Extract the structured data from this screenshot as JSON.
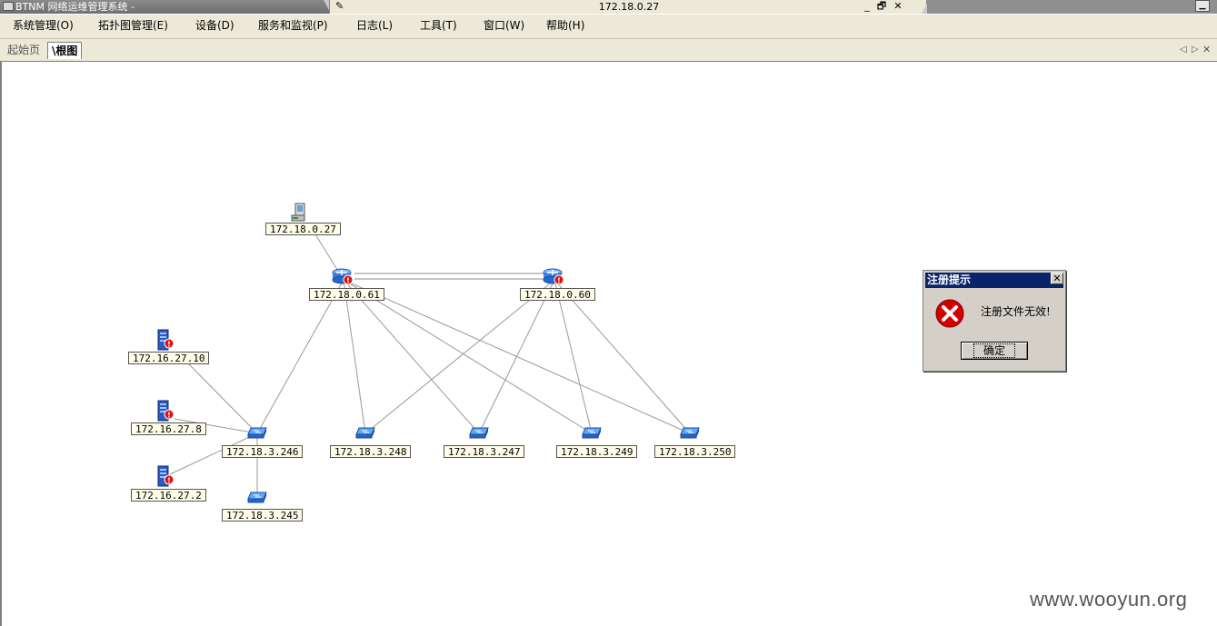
{
  "window": {
    "app_title": "BTNM 网络运维管理系统 -",
    "document_title": "172.18.0.27",
    "controls": {
      "minimize": "_",
      "restore": "🗗",
      "close": "✕"
    }
  },
  "menu": [
    {
      "label": "系统管理(O)"
    },
    {
      "label": "拓扑图管理(E)"
    },
    {
      "label": "设备(D)"
    },
    {
      "label": "服务和监视(P)"
    },
    {
      "label": "日志(L)"
    },
    {
      "label": "工具(T)"
    },
    {
      "label": "窗口(W)"
    },
    {
      "label": "帮助(H)"
    }
  ],
  "tabs": [
    {
      "label": "起始页",
      "active": false
    },
    {
      "label": "\\根图",
      "active": true
    }
  ],
  "tab_nav": {
    "prev": "◁",
    "next": "▷",
    "close": "✕"
  },
  "topology": {
    "nodes": [
      {
        "id": "host",
        "type": "workstation",
        "label": "172.18.0.27",
        "alarm": false
      },
      {
        "id": "r1",
        "type": "router",
        "label": "172.18.0.61",
        "alarm": true
      },
      {
        "id": "r2",
        "type": "router",
        "label": "172.18.0.60",
        "alarm": true
      },
      {
        "id": "srv1",
        "type": "server",
        "label": "172.16.27.10",
        "alarm": true
      },
      {
        "id": "srv2",
        "type": "server",
        "label": "172.16.27.8",
        "alarm": true
      },
      {
        "id": "srv3",
        "type": "server",
        "label": "172.16.27.2",
        "alarm": true
      },
      {
        "id": "sw246",
        "type": "switch",
        "label": "172.18.3.246",
        "alarm": false
      },
      {
        "id": "sw248",
        "type": "switch",
        "label": "172.18.3.248",
        "alarm": false
      },
      {
        "id": "sw247",
        "type": "switch",
        "label": "172.18.3.247",
        "alarm": false
      },
      {
        "id": "sw249",
        "type": "switch",
        "label": "172.18.3.249",
        "alarm": false
      },
      {
        "id": "sw250",
        "type": "switch",
        "label": "172.18.3.250",
        "alarm": false
      },
      {
        "id": "sw245",
        "type": "switch",
        "label": "172.18.3.245",
        "alarm": false
      }
    ],
    "links": [
      [
        "host",
        "r1"
      ],
      [
        "r1",
        "r2"
      ],
      [
        "r1",
        "sw246"
      ],
      [
        "r1",
        "sw248"
      ],
      [
        "r1",
        "sw247"
      ],
      [
        "r1",
        "sw249"
      ],
      [
        "r1",
        "sw250"
      ],
      [
        "r2",
        "sw248"
      ],
      [
        "r2",
        "sw247"
      ],
      [
        "r2",
        "sw249"
      ],
      [
        "r2",
        "sw250"
      ],
      [
        "srv1",
        "sw246"
      ],
      [
        "srv2",
        "sw246"
      ],
      [
        "srv3",
        "sw246"
      ],
      [
        "sw246",
        "sw245"
      ]
    ]
  },
  "dialog": {
    "title": "注册提示",
    "message": "注册文件无效!",
    "ok_label": "确定",
    "close": "✕",
    "icon": "error-icon"
  },
  "watermark": "www.wooyun.org"
}
